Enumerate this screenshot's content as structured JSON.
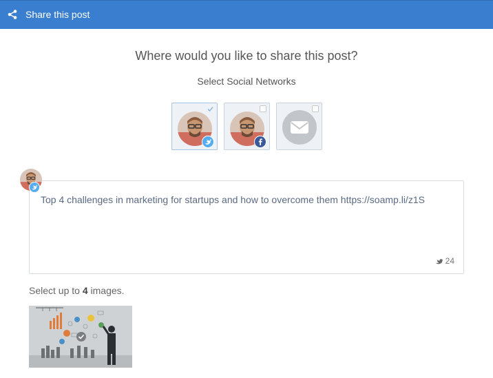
{
  "header": {
    "title": "Share this post",
    "icon": "share-icon"
  },
  "main": {
    "question": "Where would you like to share this post?",
    "networks_label": "Select Social Networks",
    "networks": [
      {
        "type": "twitter",
        "selected": true,
        "icon": "twitter-icon",
        "badge_color": "#55acee"
      },
      {
        "type": "facebook",
        "selected": false,
        "icon": "facebook-icon",
        "badge_color": "#3b5998"
      },
      {
        "type": "email",
        "selected": false,
        "icon": "email-icon"
      }
    ],
    "composer": {
      "text": "Top 4 challenges in marketing for startups and how to overcome them https://soamp.li/z1S",
      "char_count": "24"
    },
    "images": {
      "hint_prefix": "Select up to",
      "hint_count": "4",
      "hint_suffix": "images.",
      "thumbnail": {
        "selected": true
      }
    }
  },
  "colors": {
    "header": "#3a7fcf",
    "twitter": "#55acee",
    "facebook": "#3b5998"
  }
}
